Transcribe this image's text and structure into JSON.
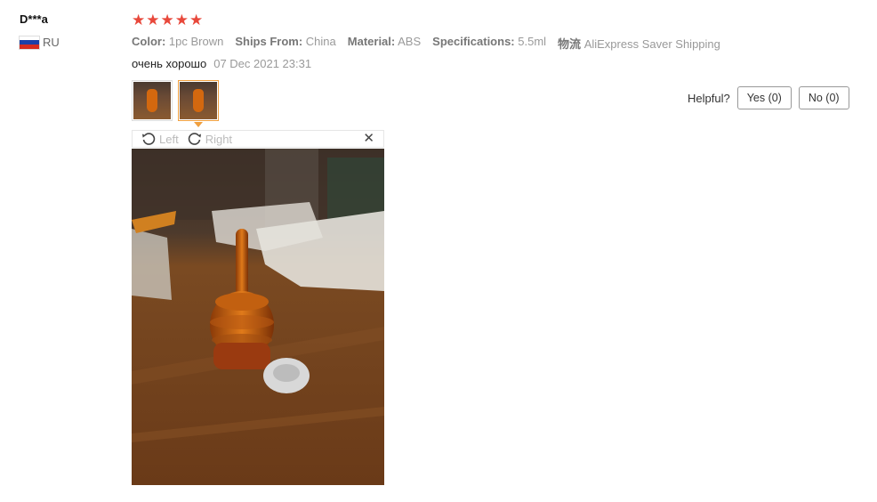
{
  "user": {
    "name": "D***a",
    "country": "RU",
    "flag_colors": [
      "#ffffff",
      "#1a3fa8",
      "#d52b1e"
    ]
  },
  "rating": {
    "stars": 5,
    "max": 5,
    "color": "#e8483b"
  },
  "attributes": [
    {
      "key": "Color:",
      "value": "1pc Brown"
    },
    {
      "key": "Ships From:",
      "value": "China"
    },
    {
      "key": "Material:",
      "value": "ABS"
    },
    {
      "key": "Specifications:",
      "value": "5.5ml"
    },
    {
      "key": "物流",
      "value": "AliExpress Saver Shipping"
    }
  ],
  "review": {
    "text": "очень хорошо",
    "date": "07 Dec 2021 23:31"
  },
  "helpful": {
    "label": "Helpful?",
    "yes": "Yes (0)",
    "no": "No (0)"
  },
  "viewer": {
    "left_label": "Left",
    "right_label": "Right",
    "close_icon": "close-icon",
    "left_icon": "rotate-left-icon",
    "right_icon": "rotate-right-icon"
  },
  "thumbnails": [
    {
      "selected": false
    },
    {
      "selected": true
    }
  ],
  "accent": "#f0a040"
}
